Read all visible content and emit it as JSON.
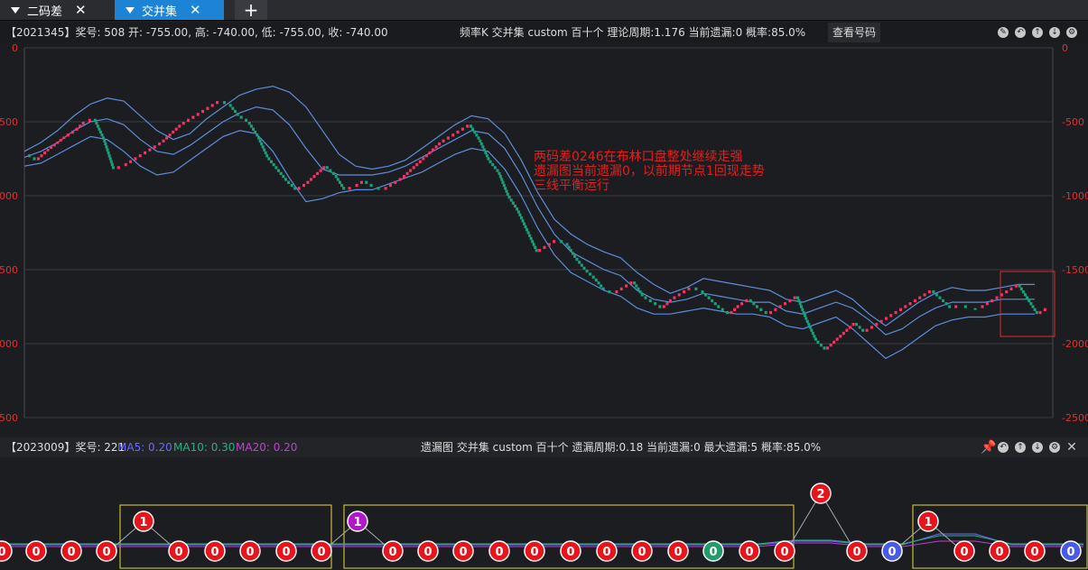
{
  "tabs": [
    {
      "label": "二码差",
      "close": "✕"
    },
    {
      "label": "交并集",
      "close": "✕"
    }
  ],
  "tab_add": "+",
  "top_info": {
    "left": "【2021345】奖号: 508  开: -755.00, 高: -740.00, 低: -755.00, 收: -740.00",
    "mid": "频率K   交并集   custom   百十个   理论周期:1.176   当前遗漏:0   概率:85.0%",
    "button": "查看号码"
  },
  "bottom_info": {
    "prefix": "【2023009】奖号: 221",
    "ma5": "MA5: 0.20",
    "ma10": "MA10: 0.30",
    "ma20": "MA20: 0.20",
    "mid": "遗漏图   交并集   custom   百十个   遗漏周期:0.18   当前遗漏:0   最大遗漏:5   概率:85.0%"
  },
  "colors": {
    "up": "#ff3060",
    "down": "#19a27a",
    "band": "#5b8ed8",
    "ma5": "#6a6aff",
    "ma10": "#2bb07d",
    "ma20": "#c040d0",
    "axis": "#e03030",
    "annotation": "#e02020",
    "box": "#e8d838"
  },
  "chart_data": {
    "type": "line",
    "left_ticks": [
      "0",
      "-500",
      "-1000",
      "-1500",
      "-2000",
      "-2500"
    ],
    "right_ticks": [
      "0",
      "-500",
      "-1000",
      "-1500",
      "-2000",
      "-2500"
    ],
    "ylim": [
      -2500,
      0
    ],
    "price": [
      -720,
      -760,
      -700,
      -650,
      -600,
      -560,
      -500,
      -480,
      -620,
      -820,
      -800,
      -760,
      -720,
      -680,
      -640,
      -580,
      -520,
      -480,
      -440,
      -400,
      -360,
      -380,
      -460,
      -500,
      -600,
      -740,
      -820,
      -900,
      -960,
      -920,
      -860,
      -800,
      -860,
      -960,
      -940,
      -900,
      -940,
      -960,
      -920,
      -880,
      -820,
      -760,
      -700,
      -640,
      -600,
      -560,
      -520,
      -620,
      -760,
      -840,
      -1000,
      -1100,
      -1240,
      -1380,
      -1340,
      -1300,
      -1320,
      -1420,
      -1500,
      -1560,
      -1640,
      -1660,
      -1620,
      -1580,
      -1680,
      -1720,
      -1760,
      -1700,
      -1660,
      -1620,
      -1640,
      -1700,
      -1760,
      -1800,
      -1740,
      -1700,
      -1760,
      -1800,
      -1760,
      -1720,
      -1680,
      -1840,
      -1980,
      -2040,
      -1980,
      -1920,
      -1860,
      -1920,
      -1880,
      -1840,
      -1800,
      -1760,
      -1720,
      -1680,
      -1640,
      -1700,
      -1760,
      -1740,
      -1760,
      -1760,
      -1720,
      -1680,
      -1640,
      -1600,
      -1700,
      -1800,
      -1760
    ],
    "upper": [
      -700,
      -640,
      -560,
      -460,
      -380,
      -340,
      -360,
      -460,
      -560,
      -620,
      -580,
      -480,
      -400,
      -320,
      -280,
      -260,
      -300,
      -400,
      -560,
      -720,
      -800,
      -820,
      -800,
      -760,
      -680,
      -600,
      -520,
      -460,
      -480,
      -580,
      -760,
      -980,
      -1160,
      -1260,
      -1330,
      -1380,
      -1420,
      -1520,
      -1600,
      -1660,
      -1620,
      -1560,
      -1580,
      -1600,
      -1620,
      -1640,
      -1700,
      -1720,
      -1680,
      -1640,
      -1700,
      -1800,
      -1880,
      -1800,
      -1720,
      -1660,
      -1620,
      -1640,
      -1640,
      -1620,
      -1600,
      -1600
    ],
    "mid": [
      -740,
      -700,
      -640,
      -560,
      -500,
      -480,
      -520,
      -620,
      -700,
      -720,
      -660,
      -580,
      -500,
      -440,
      -400,
      -420,
      -520,
      -680,
      -820,
      -860,
      -860,
      -860,
      -840,
      -800,
      -740,
      -680,
      -620,
      -560,
      -580,
      -680,
      -860,
      -1080,
      -1260,
      -1380,
      -1440,
      -1500,
      -1540,
      -1640,
      -1700,
      -1720,
      -1700,
      -1660,
      -1680,
      -1700,
      -1720,
      -1720,
      -1780,
      -1800,
      -1760,
      -1720,
      -1760,
      -1840,
      -1940,
      -1900,
      -1820,
      -1760,
      -1720,
      -1720,
      -1720,
      -1700,
      -1700,
      -1700
    ],
    "lower": [
      -800,
      -780,
      -720,
      -660,
      -600,
      -620,
      -700,
      -800,
      -860,
      -840,
      -760,
      -680,
      -600,
      -560,
      -580,
      -700,
      -880,
      -1040,
      -1020,
      -980,
      -960,
      -960,
      -920,
      -880,
      -840,
      -780,
      -720,
      -680,
      -700,
      -820,
      -1000,
      -1220,
      -1400,
      -1520,
      -1580,
      -1640,
      -1680,
      -1760,
      -1800,
      -1800,
      -1780,
      -1760,
      -1780,
      -1800,
      -1800,
      -1820,
      -1880,
      -1900,
      -1860,
      -1820,
      -1900,
      -2000,
      -2100,
      -2040,
      -1960,
      -1880,
      -1840,
      -1820,
      -1820,
      -1800,
      -1800,
      -1800
    ]
  },
  "annotation": [
    "两码差0246在布林口盘整处继续走强",
    "遗漏图当前遗漏0，以前期节点1回现走势",
    "三线平衡运行"
  ],
  "miss_bubbles": [
    {
      "v": "0",
      "c": "red",
      "x": 2
    },
    {
      "v": "0",
      "c": "red",
      "x": 40
    },
    {
      "v": "0",
      "c": "red",
      "x": 79
    },
    {
      "v": "0",
      "c": "red",
      "x": 118
    },
    {
      "v": "0",
      "c": "red",
      "x": 198
    },
    {
      "v": "0",
      "c": "red",
      "x": 238
    },
    {
      "v": "0",
      "c": "red",
      "x": 277
    },
    {
      "v": "0",
      "c": "red",
      "x": 317
    },
    {
      "v": "0",
      "c": "red",
      "x": 356
    },
    {
      "v": "0",
      "c": "red",
      "x": 435
    },
    {
      "v": "0",
      "c": "red",
      "x": 474
    },
    {
      "v": "0",
      "c": "red",
      "x": 513
    },
    {
      "v": "0",
      "c": "red",
      "x": 553
    },
    {
      "v": "0",
      "c": "red",
      "x": 592
    },
    {
      "v": "0",
      "c": "red",
      "x": 632
    },
    {
      "v": "0",
      "c": "red",
      "x": 672
    },
    {
      "v": "0",
      "c": "red",
      "x": 711
    },
    {
      "v": "0",
      "c": "red",
      "x": 751
    },
    {
      "v": "0",
      "c": "green",
      "x": 790
    },
    {
      "v": "0",
      "c": "red",
      "x": 830
    },
    {
      "v": "0",
      "c": "red",
      "x": 869
    },
    {
      "v": "0",
      "c": "red",
      "x": 949
    },
    {
      "v": "0",
      "c": "blue",
      "x": 988
    },
    {
      "v": "0",
      "c": "red",
      "x": 1068
    },
    {
      "v": "0",
      "c": "red",
      "x": 1107
    },
    {
      "v": "0",
      "c": "red",
      "x": 1146
    },
    {
      "v": "0",
      "c": "blue",
      "x": 1186
    }
  ],
  "peak_bubbles": [
    {
      "v": "1",
      "c": "red",
      "x": 159
    },
    {
      "v": "1",
      "c": "purple",
      "x": 396
    },
    {
      "v": "2",
      "c": "red",
      "x": 909
    },
    {
      "v": "1",
      "c": "red",
      "x": 1028
    }
  ]
}
